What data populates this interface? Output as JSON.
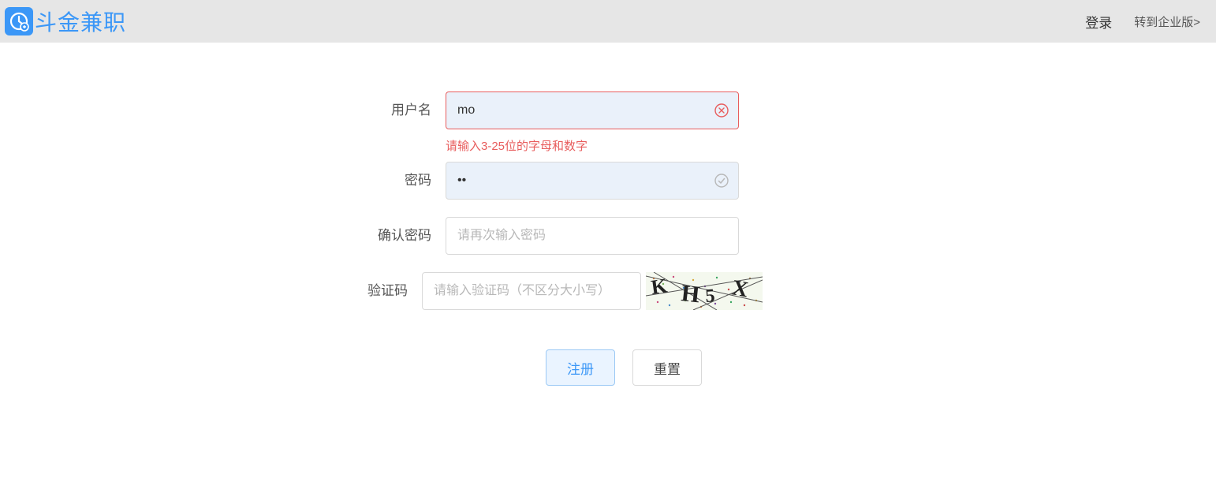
{
  "header": {
    "brand_text": "斗金兼职",
    "login_label": "登录",
    "enterprise_label": "转到企业版>"
  },
  "form": {
    "username": {
      "label": "用户名",
      "value": "mo",
      "error": "请输入3-25位的字母和数字"
    },
    "password": {
      "label": "密码",
      "value": "••"
    },
    "confirm_password": {
      "label": "确认密码",
      "placeholder": "请再次输入密码"
    },
    "captcha": {
      "label": "验证码",
      "placeholder": "请输入验证码（不区分大小写）",
      "code_display": "K H5 X"
    },
    "buttons": {
      "submit": "注册",
      "reset": "重置"
    }
  },
  "colors": {
    "primary": "#3b97f7",
    "error": "#e85d5d"
  }
}
